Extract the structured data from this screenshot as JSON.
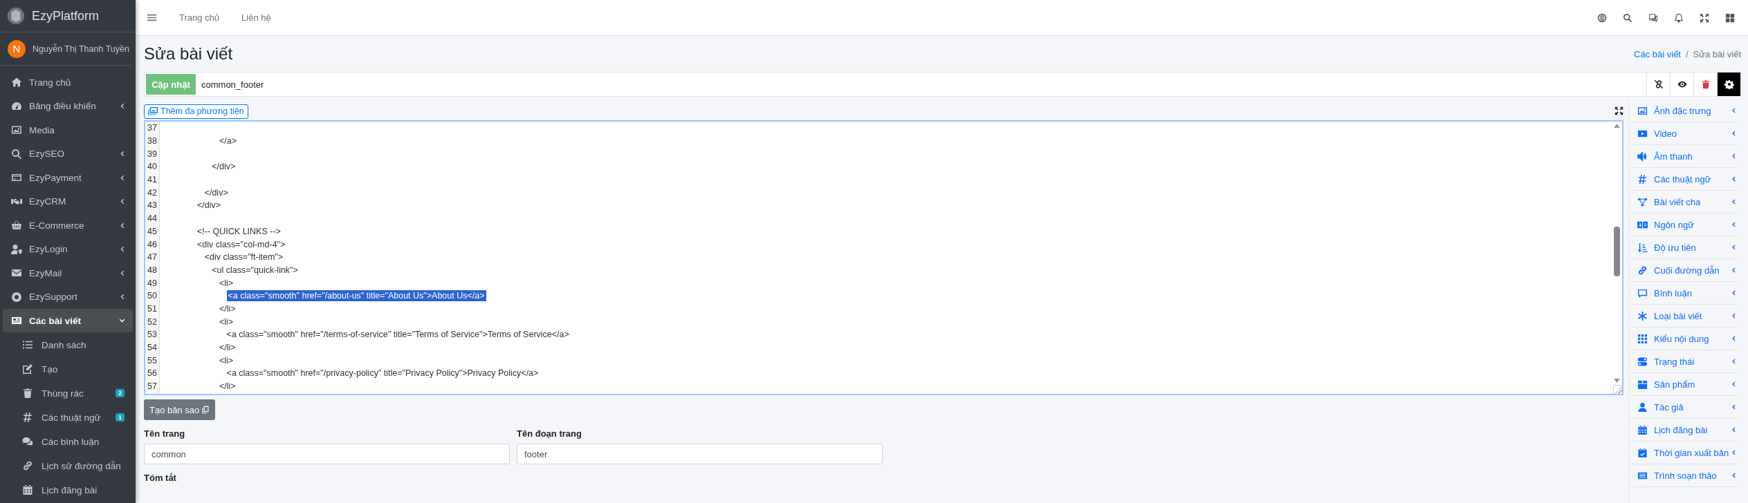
{
  "sidebar": {
    "brand": "EzyPlatform",
    "user": {
      "initial": "N",
      "name": "Nguyễn Thị Thanh Tuyền"
    },
    "items": [
      {
        "label": "Trang chủ",
        "kind": "link",
        "selected": false
      },
      {
        "label": "Bảng điều khiển",
        "kind": "menu",
        "selected": false,
        "expanded": false
      },
      {
        "label": "Media",
        "kind": "link",
        "selected": false
      },
      {
        "label": "EzySEO",
        "kind": "menu",
        "selected": false,
        "expanded": false
      },
      {
        "label": "EzyPayment",
        "kind": "menu",
        "selected": false,
        "expanded": false
      },
      {
        "label": "EzyCRM",
        "kind": "menu",
        "selected": false,
        "expanded": false
      },
      {
        "label": "E-Commerce",
        "kind": "menu",
        "selected": false,
        "expanded": false
      },
      {
        "label": "EzyLogin",
        "kind": "menu",
        "selected": false,
        "expanded": false
      },
      {
        "label": "EzyMail",
        "kind": "menu",
        "selected": false,
        "expanded": false
      },
      {
        "label": "EzySupport",
        "kind": "menu",
        "selected": false,
        "expanded": false
      },
      {
        "label": "Các bài viết",
        "kind": "menu",
        "selected": true,
        "expanded": true,
        "children": [
          {
            "label": "Danh sách",
            "selected": false
          },
          {
            "label": "Tạo",
            "selected": false
          },
          {
            "label": "Thùng rác",
            "selected": false,
            "badge": "2"
          },
          {
            "label": "Các thuật ngữ",
            "selected": false,
            "badge": "1"
          },
          {
            "label": "Các bình luận",
            "selected": false
          },
          {
            "label": "Lịch sử đường dẫn",
            "selected": false
          },
          {
            "label": "Lịch đăng bài",
            "selected": false
          }
        ]
      }
    ]
  },
  "topbar": {
    "links": [
      "Trang chủ",
      "Liên hệ"
    ]
  },
  "header": {
    "title": "Sửa bài viết",
    "separator": "/",
    "breadcrumb": [
      {
        "label": "Các bài viết",
        "link": true
      },
      {
        "label": "Sửa bài viết",
        "link": false
      }
    ]
  },
  "toolbar": {
    "update_button": "Cập nhật",
    "slug": "common_footer"
  },
  "editor": {
    "add_media_button": "Thêm đa phương tiện",
    "copy_button": "Tạo bản sao",
    "lines": [
      {
        "number": "37",
        "selected": false
      },
      {
        "number": "38",
        "code": "         </a>",
        "selected": false
      },
      {
        "number": "39",
        "selected": false
      },
      {
        "number": "40",
        "code": "      </div>",
        "selected": false
      },
      {
        "number": "41",
        "selected": false
      },
      {
        "number": "42",
        "code": "   </div>",
        "selected": false
      },
      {
        "number": "43",
        "code": "</div>",
        "selected": false
      },
      {
        "number": "44",
        "selected": false
      },
      {
        "number": "45",
        "code": "<!-- QUICK LINKS -->",
        "selected": false
      },
      {
        "number": "46",
        "code": "<div class=\"col-md-4\">",
        "selected": false
      },
      {
        "number": "47",
        "code": "   <div class=\"ft-item\">",
        "selected": false
      },
      {
        "number": "48",
        "code": "      <ul class=\"quick-link\">",
        "selected": false
      },
      {
        "number": "49",
        "code": "         <li>",
        "selected": false
      },
      {
        "number": "50",
        "code": "            <a class=\"smooth\" href=\"/about-us\" title=\"About Us\">About Us</a>",
        "selected": true
      },
      {
        "number": "51",
        "code": "         </li>",
        "selected": false
      },
      {
        "number": "52",
        "code": "         <li>",
        "selected": false
      },
      {
        "number": "53",
        "code": "            <a class=\"smooth\" href=\"/terms-of-service\" title=\"Terms of Service\">Terms of Service</a>",
        "selected": false
      },
      {
        "number": "54",
        "code": "         </li>",
        "selected": false
      },
      {
        "number": "55",
        "code": "         <li>",
        "selected": false
      },
      {
        "number": "56",
        "code": "            <a class=\"smooth\" href=\"/privacy-policy\" title=\"Privacy Policy\">Privacy Policy</a>",
        "selected": false
      },
      {
        "number": "57",
        "code": "         </li>",
        "selected": false
      }
    ]
  },
  "fields": [
    {
      "label": "Tên trang",
      "value": "common"
    },
    {
      "label": "Tên đoạn trang",
      "value": "footer"
    }
  ],
  "summary_label": "Tóm tắt",
  "side_panel": {
    "items": [
      {
        "label": "Ảnh đặc trưng",
        "expanded": false
      },
      {
        "label": "Video",
        "expanded": false
      },
      {
        "label": "Âm thanh",
        "expanded": false
      },
      {
        "label": "Các thuật ngữ",
        "expanded": false
      },
      {
        "label": "Bài viết cha",
        "expanded": false
      },
      {
        "label": "Ngôn ngữ",
        "expanded": false
      },
      {
        "label": "Độ ưu tiên",
        "expanded": false
      },
      {
        "label": "Cuối đường dẫn",
        "expanded": false
      },
      {
        "label": "Bình luận",
        "expanded": false
      },
      {
        "label": "Loại bài viết",
        "expanded": false
      },
      {
        "label": "Kiểu nội dung",
        "expanded": false
      },
      {
        "label": "Trạng thái",
        "expanded": false
      },
      {
        "label": "Sản phẩm",
        "expanded": false
      },
      {
        "label": "Tác giả",
        "expanded": false
      },
      {
        "label": "Lịch đăng bài",
        "expanded": false
      },
      {
        "label": "Thời gian xuất bản",
        "expanded": false
      },
      {
        "label": "Trình soạn thảo",
        "expanded": false
      }
    ]
  }
}
